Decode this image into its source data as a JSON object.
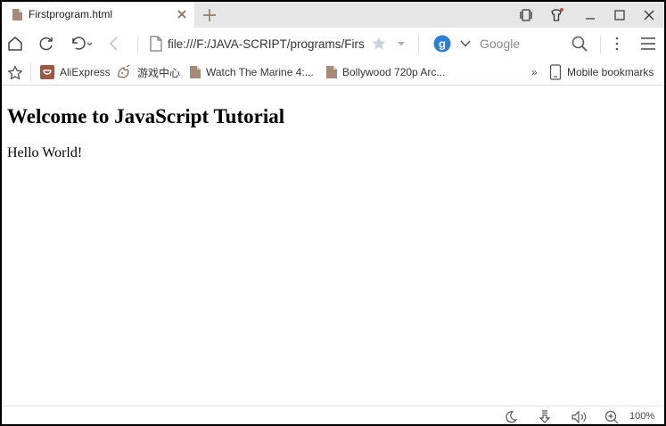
{
  "tab": {
    "title": "Firstprogram.html"
  },
  "address": {
    "url": "file:///F:/JAVA-SCRIPT/programs/Firs"
  },
  "search": {
    "placeholder": "Google",
    "engine_letter": "g",
    "engine_color": "#2d7fd1"
  },
  "bookmarks": {
    "items": [
      {
        "label": "AliExpress",
        "icon": "aliexpress-icon"
      },
      {
        "label": "游戏中心",
        "icon": "game-center-icon"
      },
      {
        "label": "Watch The Marine 4:...",
        "icon": "file-icon"
      },
      {
        "label": "Bollywood 720p Arc...",
        "icon": "file-icon"
      }
    ],
    "overflow": "»",
    "mobile_label": "Mobile bookmarks"
  },
  "page": {
    "heading": "Welcome to JavaScript Tutorial",
    "text": "Hello World!"
  },
  "status": {
    "zoom": "100%"
  },
  "colors": {
    "accent": "#8b6a55",
    "tab_bar": "#e6e6e6"
  }
}
